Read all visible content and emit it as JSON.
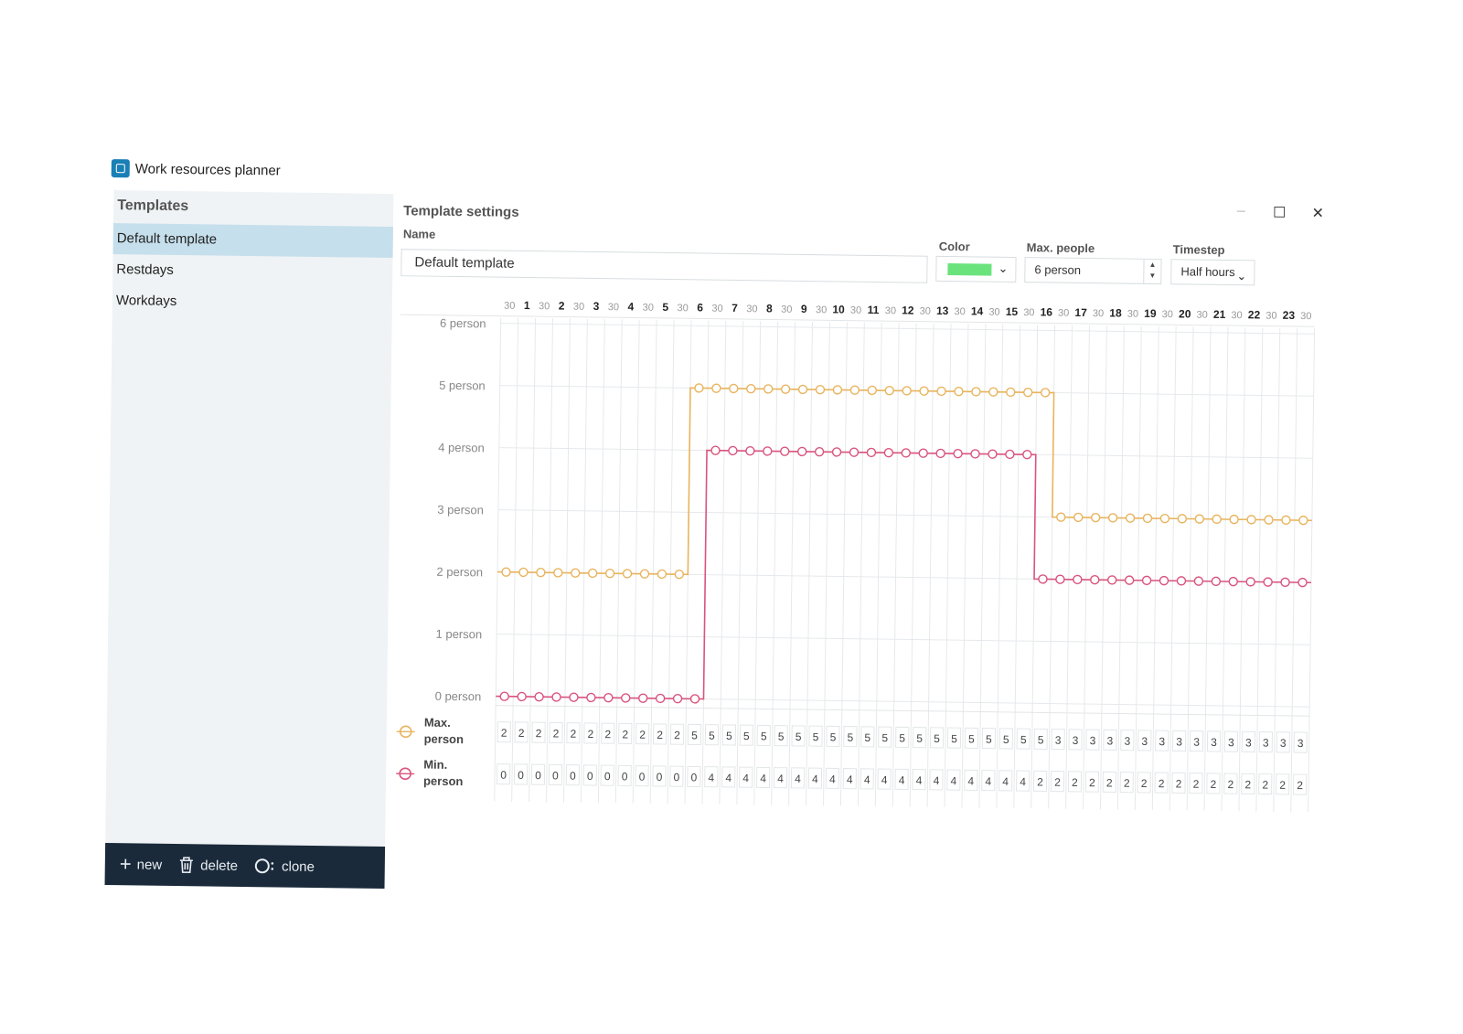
{
  "app": {
    "title": "Work resources planner"
  },
  "window_controls": {
    "minimize": "–",
    "maximize": "☐",
    "close": "✕"
  },
  "sidebar": {
    "heading": "Templates",
    "items": [
      {
        "label": "Default template",
        "selected": true
      },
      {
        "label": "Restdays",
        "selected": false
      },
      {
        "label": "Workdays",
        "selected": false
      }
    ],
    "footer": {
      "new_label": "new",
      "new_icon": "plus-icon",
      "delete_label": "delete",
      "delete_icon": "trash-icon",
      "clone_label": "clone",
      "clone_icon": "clone-icon"
    }
  },
  "settings": {
    "title": "Template settings",
    "name_label": "Name",
    "name_value": "Default template",
    "color_label": "Color",
    "color_value": "#6be37d",
    "max_people_label": "Max. people",
    "max_people_value": "6 person",
    "timestep_label": "Timestep",
    "timestep_value": "Half hours"
  },
  "chart_data": {
    "type": "line",
    "x": [
      "30",
      "1",
      "30",
      "2",
      "30",
      "3",
      "30",
      "4",
      "30",
      "5",
      "30",
      "6",
      "30",
      "7",
      "30",
      "8",
      "30",
      "9",
      "30",
      "10",
      "30",
      "11",
      "30",
      "12",
      "30",
      "13",
      "30",
      "14",
      "30",
      "15",
      "30",
      "16",
      "30",
      "17",
      "30",
      "18",
      "30",
      "19",
      "30",
      "20",
      "30",
      "21",
      "30",
      "22",
      "30",
      "23",
      "30"
    ],
    "y_ticks": [
      "0 person",
      "1 person",
      "2 person",
      "3 person",
      "4 person",
      "5 person",
      "6 person"
    ],
    "ylim": [
      0,
      6
    ],
    "series": [
      {
        "name": "Max. person",
        "color": "#e8b45e",
        "values": [
          2,
          2,
          2,
          2,
          2,
          2,
          2,
          2,
          2,
          2,
          2,
          5,
          5,
          5,
          5,
          5,
          5,
          5,
          5,
          5,
          5,
          5,
          5,
          5,
          5,
          5,
          5,
          5,
          5,
          5,
          5,
          5,
          3,
          3,
          3,
          3,
          3,
          3,
          3,
          3,
          3,
          3,
          3,
          3,
          3,
          3,
          3
        ]
      },
      {
        "name": "Min. person",
        "color": "#d9547e",
        "values": [
          0,
          0,
          0,
          0,
          0,
          0,
          0,
          0,
          0,
          0,
          0,
          0,
          4,
          4,
          4,
          4,
          4,
          4,
          4,
          4,
          4,
          4,
          4,
          4,
          4,
          4,
          4,
          4,
          4,
          4,
          4,
          2,
          2,
          2,
          2,
          2,
          2,
          2,
          2,
          2,
          2,
          2,
          2,
          2,
          2,
          2,
          2
        ]
      }
    ]
  }
}
